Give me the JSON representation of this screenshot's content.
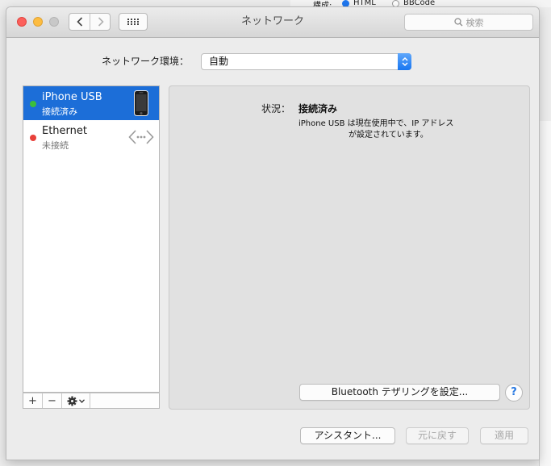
{
  "background_app": {
    "label": "構成:",
    "option1": "HTML",
    "option2": "BBCode"
  },
  "window": {
    "title": "ネットワーク",
    "search_placeholder": "検索"
  },
  "location": {
    "label": "ネットワーク環境：",
    "value": "自動"
  },
  "services": [
    {
      "name": "iPhone USB",
      "status": "接続済み",
      "dot_color": "#3cbf3c",
      "icon": "iphone-icon",
      "selected": true
    },
    {
      "name": "Ethernet",
      "status": "未接続",
      "dot_color": "#e8403a",
      "icon": "ethernet-icon",
      "selected": false
    }
  ],
  "list_toolbar": {
    "add": "+",
    "remove": "−"
  },
  "detail": {
    "status_label": "状況：",
    "status_value": "接続済み",
    "description_line1": "iPhone USB は現在使用中で、IP アドレス",
    "description_line2": "が設定されています。",
    "bluetooth_button": "Bluetooth テザリングを設定...",
    "help": "?"
  },
  "footer": {
    "assistant": "アシスタント...",
    "revert": "元に戻す",
    "apply": "適用"
  },
  "colors": {
    "selection": "#1c6ed8",
    "accent": "#1876f1"
  }
}
